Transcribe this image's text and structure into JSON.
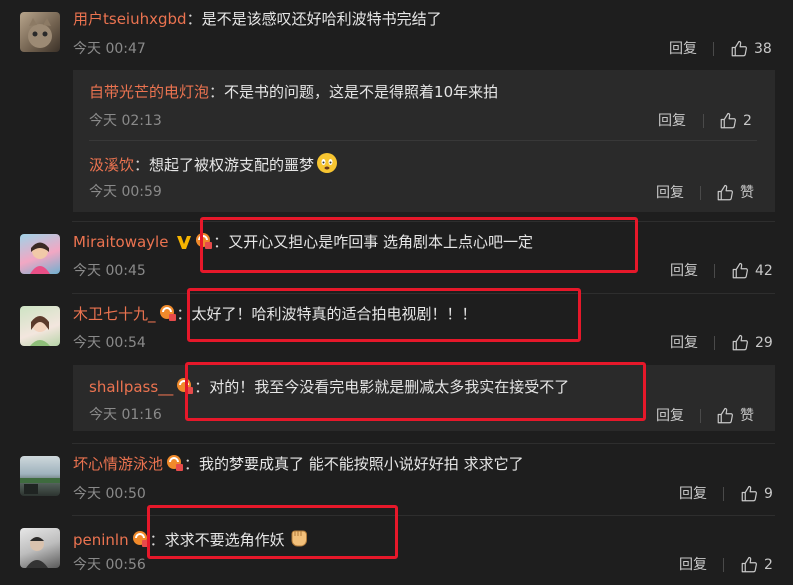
{
  "colors": {
    "background": "#1e1e1e",
    "username": "#eb7350",
    "subbox": "#2a2a2a",
    "highlight_box": "#e6182a"
  },
  "comments": [
    {
      "user": "用户tseiuhxgbd",
      "text": "是不是该感叹还好哈利波特书完结了",
      "time": "今天 00:47",
      "reply": "回复",
      "likes": "38",
      "replies": [
        {
          "user": "自带光芒的电灯泡",
          "text": "不是书的问题，这是不是得照着10年来拍",
          "time": "今天 02:13",
          "reply": "回复",
          "likes": "2"
        },
        {
          "user": "汲溪饮",
          "text": "想起了被权游支配的噩梦",
          "time": "今天 00:59",
          "reply": "回复",
          "likes": "赞"
        }
      ]
    },
    {
      "user": "Miraitowayle",
      "text": "又开心又担心是咋回事 选角剧本上点心吧一定",
      "time": "今天 00:45",
      "reply": "回复",
      "likes": "42"
    },
    {
      "user": "木卫七十九_",
      "text": "太好了！哈利波特真的适合拍电视剧！！！",
      "time": "今天 00:54",
      "reply": "回复",
      "likes": "29",
      "replies": [
        {
          "user": "shallpass__",
          "text": "对的！我至今没看完电影就是删减太多我实在接受不了",
          "time": "今天 01:16",
          "reply": "回复",
          "likes": "赞"
        }
      ]
    },
    {
      "user": "坏心情游泳池",
      "text": "我的梦要成真了 能不能按照小说好好拍 求求它了",
      "time": "今天 00:50",
      "reply": "回复",
      "likes": "9"
    },
    {
      "user": "peninln",
      "text": "求求不要选角作妖",
      "time": "今天 00:56",
      "reply": "回复",
      "likes": "2"
    }
  ]
}
